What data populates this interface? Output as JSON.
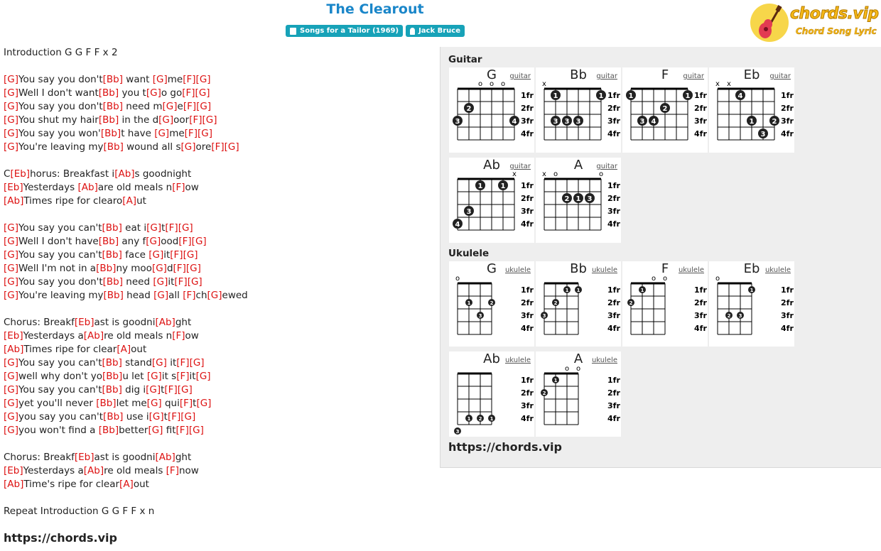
{
  "header": {
    "title": "The Clearout",
    "album_badge": "Songs for a Tailor (1969)",
    "artist_badge": "Jack Bruce"
  },
  "logo": {
    "text": "chords.vip",
    "subtitle": "Chord Song Lyric"
  },
  "lyrics": [
    [
      {
        "t": "Introduction G G F F x 2"
      }
    ],
    [],
    [
      {
        "c": "G"
      },
      {
        "t": "You say you don't"
      },
      {
        "c": "Bb"
      },
      {
        "t": " want "
      },
      {
        "c": "G"
      },
      {
        "t": "me"
      },
      {
        "c": "F"
      },
      {
        "c": "G"
      }
    ],
    [
      {
        "c": "G"
      },
      {
        "t": "Well I don't want"
      },
      {
        "c": "Bb"
      },
      {
        "t": " you t"
      },
      {
        "c": "G"
      },
      {
        "t": "o go"
      },
      {
        "c": "F"
      },
      {
        "c": "G"
      }
    ],
    [
      {
        "c": "G"
      },
      {
        "t": "You say you don't"
      },
      {
        "c": "Bb"
      },
      {
        "t": " need m"
      },
      {
        "c": "G"
      },
      {
        "t": "e"
      },
      {
        "c": "F"
      },
      {
        "c": "G"
      }
    ],
    [
      {
        "c": "G"
      },
      {
        "t": "You shut my hair"
      },
      {
        "c": "Bb"
      },
      {
        "t": " in the d"
      },
      {
        "c": "G"
      },
      {
        "t": "oor"
      },
      {
        "c": "F"
      },
      {
        "c": "G"
      }
    ],
    [
      {
        "c": "G"
      },
      {
        "t": "You say you won'"
      },
      {
        "c": "Bb"
      },
      {
        "t": "t have "
      },
      {
        "c": "G"
      },
      {
        "t": "me"
      },
      {
        "c": "F"
      },
      {
        "c": "G"
      }
    ],
    [
      {
        "c": "G"
      },
      {
        "t": "You're leaving my"
      },
      {
        "c": "Bb"
      },
      {
        "t": " wound all s"
      },
      {
        "c": "G"
      },
      {
        "t": "ore"
      },
      {
        "c": "F"
      },
      {
        "c": "G"
      }
    ],
    [],
    [
      {
        "t": "C"
      },
      {
        "c": "Eb"
      },
      {
        "t": "horus: Breakfast i"
      },
      {
        "c": "Ab"
      },
      {
        "t": "s goodnight"
      }
    ],
    [
      {
        "c": "Eb"
      },
      {
        "t": "Yesterdays "
      },
      {
        "c": "Ab"
      },
      {
        "t": "are old meals n"
      },
      {
        "c": "F"
      },
      {
        "t": "ow"
      }
    ],
    [
      {
        "c": "Ab"
      },
      {
        "t": "Times ripe for clearo"
      },
      {
        "c": "A"
      },
      {
        "t": "ut"
      }
    ],
    [],
    [
      {
        "c": "G"
      },
      {
        "t": "You say you can't"
      },
      {
        "c": "Bb"
      },
      {
        "t": " eat i"
      },
      {
        "c": "G"
      },
      {
        "t": "t"
      },
      {
        "c": "F"
      },
      {
        "c": "G"
      }
    ],
    [
      {
        "c": "G"
      },
      {
        "t": "Well I don't have"
      },
      {
        "c": "Bb"
      },
      {
        "t": " any f"
      },
      {
        "c": "G"
      },
      {
        "t": "ood"
      },
      {
        "c": "F"
      },
      {
        "c": "G"
      }
    ],
    [
      {
        "c": "G"
      },
      {
        "t": "You say you can't"
      },
      {
        "c": "Bb"
      },
      {
        "t": " face "
      },
      {
        "c": "G"
      },
      {
        "t": "it"
      },
      {
        "c": "F"
      },
      {
        "c": "G"
      }
    ],
    [
      {
        "c": "G"
      },
      {
        "t": "Well I'm not in a"
      },
      {
        "c": "Bb"
      },
      {
        "t": "ny moo"
      },
      {
        "c": "G"
      },
      {
        "t": "d"
      },
      {
        "c": "F"
      },
      {
        "c": "G"
      }
    ],
    [
      {
        "c": "G"
      },
      {
        "t": "You say you don't"
      },
      {
        "c": "Bb"
      },
      {
        "t": " need "
      },
      {
        "c": "G"
      },
      {
        "t": "it"
      },
      {
        "c": "F"
      },
      {
        "c": "G"
      }
    ],
    [
      {
        "c": "G"
      },
      {
        "t": "You're leaving my"
      },
      {
        "c": "Bb"
      },
      {
        "t": " head "
      },
      {
        "c": "G"
      },
      {
        "t": "all "
      },
      {
        "c": "F"
      },
      {
        "t": "ch"
      },
      {
        "c": "G"
      },
      {
        "t": "ewed"
      }
    ],
    [],
    [
      {
        "t": "Chorus: Breakf"
      },
      {
        "c": "Eb"
      },
      {
        "t": "ast is goodni"
      },
      {
        "c": "Ab"
      },
      {
        "t": "ght"
      }
    ],
    [
      {
        "c": "Eb"
      },
      {
        "t": "Yesterdays a"
      },
      {
        "c": "Ab"
      },
      {
        "t": "re old meals n"
      },
      {
        "c": "F"
      },
      {
        "t": "ow"
      }
    ],
    [
      {
        "c": "Ab"
      },
      {
        "t": "Times ripe for clear"
      },
      {
        "c": "A"
      },
      {
        "t": "out"
      }
    ],
    [
      {
        "c": "G"
      },
      {
        "t": "You say you can't"
      },
      {
        "c": "Bb"
      },
      {
        "t": " stand"
      },
      {
        "c": "G"
      },
      {
        "t": " it"
      },
      {
        "c": "F"
      },
      {
        "c": "G"
      }
    ],
    [
      {
        "c": "G"
      },
      {
        "t": "well why don't yo"
      },
      {
        "c": "Bb"
      },
      {
        "t": "u let "
      },
      {
        "c": "G"
      },
      {
        "t": "it s"
      },
      {
        "c": "F"
      },
      {
        "t": "it"
      },
      {
        "c": "G"
      }
    ],
    [
      {
        "c": "G"
      },
      {
        "t": "You say you can't"
      },
      {
        "c": "Bb"
      },
      {
        "t": " dig i"
      },
      {
        "c": "G"
      },
      {
        "t": "t"
      },
      {
        "c": "F"
      },
      {
        "c": "G"
      }
    ],
    [
      {
        "c": "G"
      },
      {
        "t": "yet you'll never "
      },
      {
        "c": "Bb"
      },
      {
        "t": "let me"
      },
      {
        "c": "G"
      },
      {
        "t": " qui"
      },
      {
        "c": "F"
      },
      {
        "t": "t"
      },
      {
        "c": "G"
      }
    ],
    [
      {
        "c": "G"
      },
      {
        "t": "you say you can't"
      },
      {
        "c": "Bb"
      },
      {
        "t": " use i"
      },
      {
        "c": "G"
      },
      {
        "t": "t"
      },
      {
        "c": "F"
      },
      {
        "c": "G"
      }
    ],
    [
      {
        "c": "G"
      },
      {
        "t": "you won't find a "
      },
      {
        "c": "Bb"
      },
      {
        "t": "better"
      },
      {
        "c": "G"
      },
      {
        "t": " fit"
      },
      {
        "c": "F"
      },
      {
        "c": "G"
      }
    ],
    [],
    [
      {
        "t": "Chorus: Breakf"
      },
      {
        "c": "Eb"
      },
      {
        "t": "ast is goodni"
      },
      {
        "c": "Ab"
      },
      {
        "t": "ght"
      }
    ],
    [
      {
        "c": "Eb"
      },
      {
        "t": "Yesterdays a"
      },
      {
        "c": "Ab"
      },
      {
        "t": "re old meals "
      },
      {
        "c": "F"
      },
      {
        "t": "now"
      }
    ],
    [
      {
        "c": "Ab"
      },
      {
        "t": "Time's ripe for clear"
      },
      {
        "c": "A"
      },
      {
        "t": "out"
      }
    ],
    [],
    [
      {
        "t": "Repeat Introduction G G F F x n"
      }
    ]
  ],
  "site_url_bottom": "https://chords.vip",
  "panel": {
    "guitar_title": "Guitar",
    "ukulele_title": "Ukulele",
    "site_url": "https://chords.vip",
    "guitar_link": "guitar",
    "ukulele_link": "ukulele",
    "fret_labels": [
      "1fr",
      "2fr",
      "3fr",
      "4fr"
    ]
  },
  "guitar_chords": [
    {
      "name": "G",
      "marks": [
        "",
        "",
        "o",
        "o",
        "o",
        ""
      ],
      "dots": [
        [
          1,
          3,
          "3"
        ],
        [
          2,
          2,
          "2"
        ],
        [
          6,
          3,
          "4"
        ]
      ],
      "barres": []
    },
    {
      "name": "Bb",
      "marks": [
        "x",
        "",
        "",
        "",
        "",
        ""
      ],
      "dots": [
        [
          2,
          3,
          "3"
        ],
        [
          3,
          3,
          "3"
        ],
        [
          4,
          3,
          "3"
        ]
      ],
      "barres": [
        [
          2,
          6,
          1,
          "1"
        ]
      ]
    },
    {
      "name": "F",
      "marks": [
        "",
        "",
        "",
        "",
        "",
        ""
      ],
      "dots": [
        [
          2,
          3,
          "3"
        ],
        [
          3,
          3,
          "4"
        ],
        [
          4,
          2,
          "2"
        ]
      ],
      "barres": [
        [
          1,
          6,
          1,
          "1"
        ]
      ]
    },
    {
      "name": "Eb",
      "marks": [
        "x",
        "x",
        "",
        "",
        "",
        ""
      ],
      "dots": [
        [
          3,
          1,
          "4"
        ],
        [
          4,
          3,
          "1"
        ],
        [
          5,
          4,
          "3"
        ],
        [
          6,
          3,
          "2"
        ]
      ],
      "barres": []
    },
    {
      "name": "Ab",
      "marks": [
        "",
        "",
        "",
        "",
        "",
        "x"
      ],
      "dots": [
        [
          1,
          4,
          "4"
        ],
        [
          2,
          3,
          "3"
        ]
      ],
      "barres": [
        [
          3,
          5,
          1,
          "1"
        ]
      ]
    },
    {
      "name": "A",
      "marks": [
        "x",
        "o",
        "",
        "",
        "",
        "o"
      ],
      "dots": [
        [
          3,
          2,
          "2"
        ],
        [
          4,
          2,
          "1"
        ],
        [
          5,
          2,
          "3"
        ]
      ],
      "barres": []
    }
  ],
  "ukulele_chords": [
    {
      "name": "G",
      "marks": [
        "o",
        "",
        "",
        ""
      ],
      "dots": [
        [
          2,
          2,
          "1"
        ],
        [
          3,
          3,
          "3"
        ],
        [
          4,
          2,
          "2"
        ]
      ]
    },
    {
      "name": "Bb",
      "marks": [
        "",
        "",
        "",
        ""
      ],
      "dots": [
        [
          1,
          3,
          "3"
        ],
        [
          2,
          2,
          "2"
        ],
        [
          3,
          1,
          "1"
        ],
        [
          4,
          1,
          "1"
        ]
      ]
    },
    {
      "name": "F",
      "marks": [
        "",
        "",
        "o",
        "o"
      ],
      "dots": [
        [
          1,
          2,
          "2"
        ],
        [
          2,
          1,
          "1"
        ]
      ]
    },
    {
      "name": "Eb",
      "marks": [
        "o",
        "",
        "",
        ""
      ],
      "dots": [
        [
          2,
          3,
          "2"
        ],
        [
          3,
          3,
          "3"
        ],
        [
          4,
          1,
          "1"
        ]
      ]
    },
    {
      "name": "Ab",
      "marks": [
        "",
        "",
        "",
        ""
      ],
      "dots": [
        [
          1,
          5,
          "3"
        ],
        [
          2,
          4,
          "1"
        ],
        [
          3,
          4,
          "2"
        ],
        [
          4,
          4,
          "1"
        ]
      ]
    },
    {
      "name": "A",
      "marks": [
        "",
        "",
        "o",
        "o"
      ],
      "dots": [
        [
          1,
          2,
          "2"
        ],
        [
          2,
          1,
          "1"
        ]
      ]
    }
  ]
}
